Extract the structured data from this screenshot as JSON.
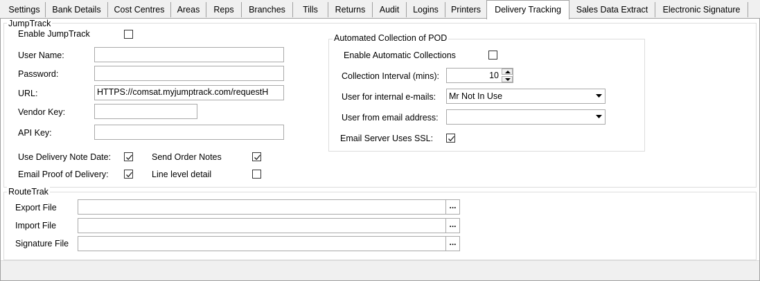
{
  "tabs": [
    {
      "label": "Settings"
    },
    {
      "label": "Bank Details"
    },
    {
      "label": "Cost Centres"
    },
    {
      "label": "Areas"
    },
    {
      "label": "Reps"
    },
    {
      "label": "Branches"
    },
    {
      "label": "Tills"
    },
    {
      "label": "Returns"
    },
    {
      "label": "Audit"
    },
    {
      "label": "Logins"
    },
    {
      "label": "Printers"
    },
    {
      "label": "Delivery Tracking"
    },
    {
      "label": "Sales Data Extract"
    },
    {
      "label": "Electronic Signature"
    }
  ],
  "jumptrack": {
    "title": "JumpTrack",
    "enable_label": "Enable JumpTrack",
    "enable_checked": false,
    "user_name_label": "User Name:",
    "user_name_value": "",
    "password_label": "Password:",
    "password_value": "",
    "url_label": "URL:",
    "url_value": "HTTPS://comsat.myjumptrack.com/requestH",
    "vendor_key_label": "Vendor Key:",
    "vendor_key_value": "",
    "api_key_label": "API Key:",
    "api_key_value": "",
    "use_delivery_note_date_label": "Use Delivery Note Date:",
    "use_delivery_note_date_checked": true,
    "send_order_notes_label": "Send Order Notes",
    "send_order_notes_checked": true,
    "email_pod_label": "Email Proof of Delivery:",
    "email_pod_checked": true,
    "line_level_detail_label": "Line level detail",
    "line_level_detail_checked": false
  },
  "pod": {
    "title": "Automated Collection of POD",
    "enable_auto_label": "Enable Automatic Collections",
    "enable_auto_checked": false,
    "interval_label": "Collection Interval (mins):",
    "interval_value": "10",
    "internal_user_label": "User for internal e-mails:",
    "internal_user_value": "Mr Not In Use",
    "from_address_label": "User from email address:",
    "from_address_value": "",
    "ssl_label": "Email Server Uses SSL:",
    "ssl_checked": true
  },
  "routetrak": {
    "title": "RouteTrak",
    "export_label": "Export File",
    "export_value": "",
    "import_label": "Import File",
    "import_value": "",
    "signature_label": "Signature File",
    "signature_value": "",
    "browse_label": "..."
  }
}
